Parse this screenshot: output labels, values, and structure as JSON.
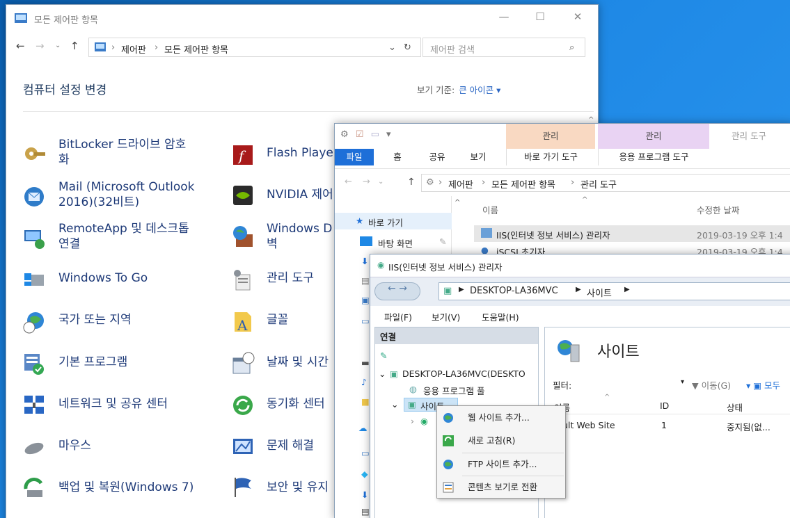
{
  "control_panel": {
    "title": "모든 제어판 항목",
    "breadcrumb": [
      "제어판",
      "모든 제어판 항목"
    ],
    "search_placeholder": "제어판 검색",
    "heading": "컴퓨터 설정 변경",
    "view_by_label": "보기 기준:",
    "view_by_value": "큰 아이콘 ▾",
    "items_col1": [
      {
        "line1": "BitLocker 드라이브 암호",
        "line2": "화",
        "icon": "bitlocker-key-icon"
      },
      {
        "line1": "Mail (Microsoft Outlook",
        "line2": "2016)(32비트)",
        "icon": "mail-icon"
      },
      {
        "line1": "RemoteApp 및 데스크톱",
        "line2": "연결",
        "icon": "remoteapp-icon"
      },
      {
        "line1": "Windows To Go",
        "line2": "",
        "icon": "usb-icon"
      },
      {
        "line1": "국가 또는 지역",
        "line2": "",
        "icon": "globe-clock-icon"
      },
      {
        "line1": "기본 프로그램",
        "line2": "",
        "icon": "default-programs-icon"
      },
      {
        "line1": "네트워크 및 공유 센터",
        "line2": "",
        "icon": "network-icon"
      },
      {
        "line1": "마우스",
        "line2": "",
        "icon": "mouse-icon"
      },
      {
        "line1": "백업 및 복원(Windows 7)",
        "line2": "",
        "icon": "backup-icon"
      }
    ],
    "items_col2": [
      {
        "line1": "Flash Playe",
        "line2": "",
        "icon": "flash-icon"
      },
      {
        "line1": "NVIDIA 제어",
        "line2": "",
        "icon": "nvidia-icon"
      },
      {
        "line1": "Windows D",
        "line2": "벽",
        "icon": "firewall-icon"
      },
      {
        "line1": "관리 도구",
        "line2": "",
        "icon": "admin-tools-icon"
      },
      {
        "line1": "글꼴",
        "line2": "",
        "icon": "fonts-icon"
      },
      {
        "line1": "날짜 및 시간",
        "line2": "",
        "icon": "calendar-icon"
      },
      {
        "line1": "동기화 센터",
        "line2": "",
        "icon": "sync-icon"
      },
      {
        "line1": "문제 해결",
        "line2": "",
        "icon": "troubleshoot-icon"
      },
      {
        "line1": "보안 및 유지",
        "line2": "",
        "icon": "flag-icon"
      }
    ]
  },
  "explorer": {
    "ctx_tab1": "관리",
    "ctx_tab2": "관리",
    "window_title": "관리 도구",
    "tabs": [
      "파일",
      "홈",
      "공유",
      "보기",
      "바로 가기 도구",
      "응용 프로그램 도구"
    ],
    "breadcrumb": [
      "제어판",
      "모든 제어판 항목",
      "관리 도구"
    ],
    "nav": {
      "quick": "바로 가기",
      "desktop": "바탕 화면"
    },
    "col_name": "이름",
    "col_date": "수정한 날짜",
    "files": [
      {
        "name": "IIS(인터넷 정보 서비스) 관리자",
        "date": "2019-03-19 오후 1:4"
      },
      {
        "name": "iSCSI 초기자",
        "date": "2019-03-19 오후 1:4"
      }
    ]
  },
  "iis": {
    "title": "IIS(인터넷 정보 서비스) 관리자",
    "address": [
      "DESKTOP-LA36MVC",
      "사이트"
    ],
    "menu": [
      "파일(F)",
      "보기(V)",
      "도움말(H)"
    ],
    "connections_label": "연결",
    "tree": {
      "server": "DESKTOP-LA36MVC(DESKTO",
      "app_pools": "응용 프로그램 풀",
      "sites": "사이트"
    },
    "sites_heading": "사이트",
    "filter_label": "필터:",
    "go_label": "이동(G)",
    "show_all_label": "모두",
    "columns": {
      "name": "이름",
      "id": "ID",
      "state": "상태"
    },
    "rows": [
      {
        "name": "fault Web Site",
        "id": "1",
        "state": "중지됨(없..."
      }
    ],
    "context_menu": [
      "웹 사이트 추가...",
      "새로 고침(R)",
      "FTP 사이트 추가...",
      "콘텐츠 보기로 전환"
    ]
  },
  "colors": {
    "accent": "#1e6fd8",
    "ctx_tab1": "#f9d9c2",
    "ctx_tab2": "#e9d3f3"
  }
}
